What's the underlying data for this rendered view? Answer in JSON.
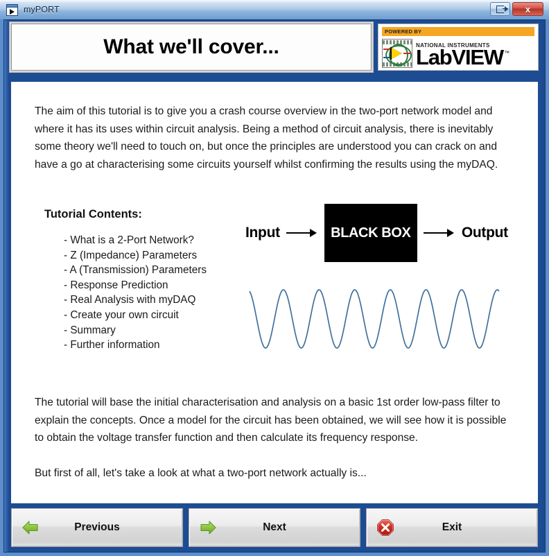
{
  "window": {
    "title": "myPORT",
    "icon": "labview-vi-icon",
    "controls": [
      {
        "name": "restore-button",
        "icon": "restore-window-icon",
        "label": ""
      },
      {
        "name": "close-button",
        "icon": "close-x-icon",
        "label": "x"
      }
    ]
  },
  "header": {
    "banner_title": "What we'll cover...",
    "logo": {
      "powered_by": "POWERED BY",
      "company": "NATIONAL INSTRUMENTS",
      "product": "LabVIEW",
      "trademark": "™"
    }
  },
  "content": {
    "intro_paragraph": "The aim of this tutorial is to give you a crash course overview in the two-port network model and where it has its uses within circuit analysis. Being a method of circuit analysis, there is inevitably some theory we'll need to touch on, but once the principles are understood you can crack on and have a go at characterising some circuits yourself whilst confirming the results using the myDAQ.",
    "contents_heading": "Tutorial Contents:",
    "contents_items": [
      "- What is a 2-Port Network?",
      "- Z (Impedance) Parameters",
      "- A (Transmission) Parameters",
      "- Response Prediction",
      "- Real Analysis with myDAQ",
      "- Create your own circuit",
      "- Summary",
      "- Further information"
    ],
    "diagram": {
      "input_label": "Input",
      "box_label": "BLACK BOX",
      "output_label": "Output"
    },
    "waveform": {
      "description": "sine-wave",
      "color": "#41709c",
      "cycles": 7
    },
    "filter_paragraph": "The tutorial will base the initial characterisation and analysis on a basic 1st order low-pass filter to explain the concepts. Once a model for the circuit has been obtained, we will see how it is possible to obtain the voltage transfer function and then calculate its frequency response.",
    "closing_paragraph": "But first of all, let's take a look at what a two-port network actually is..."
  },
  "buttons": [
    {
      "name": "previous-button",
      "label": "Previous",
      "icon": "green-left-arrow-icon"
    },
    {
      "name": "next-button",
      "label": "Next",
      "icon": "green-right-arrow-icon"
    },
    {
      "name": "exit-button",
      "label": "Exit",
      "icon": "red-stop-x-icon"
    }
  ],
  "colors": {
    "frame_blue": "#1d4c93",
    "titlebar_blue": "#a9c7e6",
    "logo_orange": "#f5a623",
    "wave_blue": "#41709c",
    "close_red": "#c0392b",
    "arrow_green": "#76b82a"
  }
}
